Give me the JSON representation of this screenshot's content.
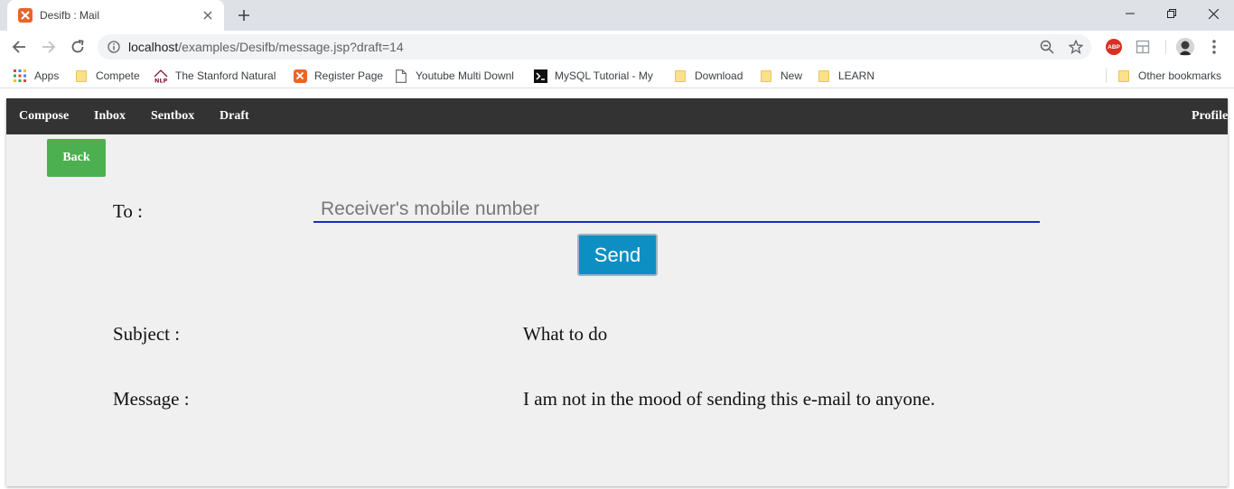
{
  "browser": {
    "tab_title": "Desifb : Mail",
    "url_host": "localhost",
    "url_path": "/examples/Desifb/message.jsp?draft=14",
    "abp_badge": "ABP",
    "icons": [
      "xampp-favicon-icon",
      "close-icon",
      "plus-icon",
      "minimize-icon",
      "maximize-icon",
      "window-close-icon",
      "back-arrow-icon",
      "forward-arrow-icon",
      "reload-icon",
      "info-icon",
      "zoom-icon",
      "star-icon",
      "adblock-icon",
      "extension-icon",
      "avatar",
      "more-menu-icon"
    ]
  },
  "bookmarks": {
    "items": [
      {
        "label": "Apps",
        "icon": "apps-grid-icon"
      },
      {
        "label": "Compete",
        "icon": "folder-icon"
      },
      {
        "label": "The Stanford Natural",
        "icon": "nlp-icon"
      },
      {
        "label": "Register Page",
        "icon": "xampp-icon"
      },
      {
        "label": "Youtube Multi Downl",
        "icon": "page-icon"
      },
      {
        "label": "MySQL Tutorial - My",
        "icon": "terminal-icon"
      },
      {
        "label": "Download",
        "icon": "folder-icon"
      },
      {
        "label": "New",
        "icon": "folder-icon"
      },
      {
        "label": "LEARN",
        "icon": "folder-icon"
      }
    ],
    "other": "Other bookmarks"
  },
  "nav": {
    "compose": "Compose",
    "inbox": "Inbox",
    "sentbox": "Sentbox",
    "draft": "Draft",
    "profile": "Profile"
  },
  "form": {
    "back_label": "Back",
    "to_label": "To :",
    "to_placeholder": "Receiver's mobile number",
    "to_value": "",
    "send_label": "Send",
    "subject_label": "Subject :",
    "subject_value": "What to do",
    "message_label": "Message :",
    "message_value": "I am not in the mood of sending this e-mail to anyone."
  },
  "colors": {
    "navbar": "#333333",
    "back_button": "#4caf50",
    "send_button": "#0e8fc4",
    "input_underline": "#1a2bc9",
    "page_background": "#f0f0f0"
  }
}
